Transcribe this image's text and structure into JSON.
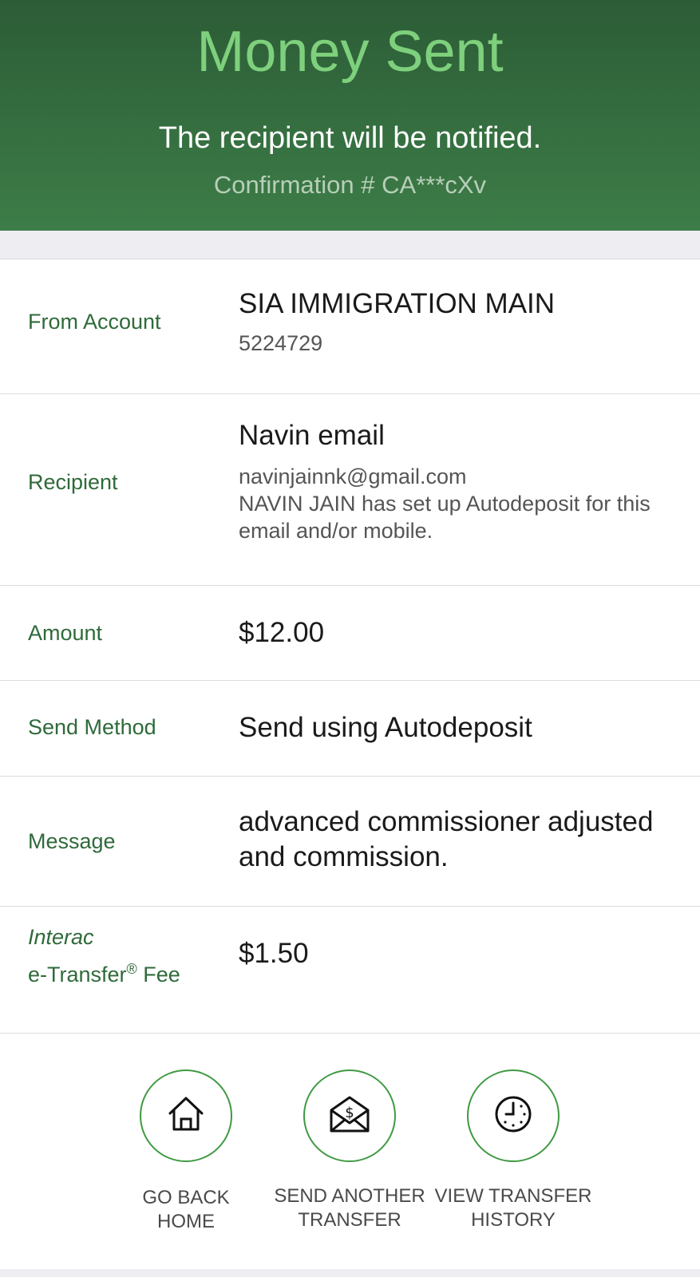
{
  "header": {
    "title": "Money Sent",
    "subtitle": "The recipient will be notified.",
    "confirmation": "Confirmation # CA***cXv"
  },
  "details": {
    "from_account": {
      "label": "From Account",
      "name": "SIA IMMIGRATION MAIN",
      "number": "5224729"
    },
    "recipient": {
      "label": "Recipient",
      "name": "Navin email",
      "email": "navinjainnk@gmail.com",
      "note": "NAVIN JAIN has set up Autodeposit for this email and/or mobile."
    },
    "amount": {
      "label": "Amount",
      "value": "$12.00"
    },
    "send_method": {
      "label": "Send Method",
      "value": "Send using Autodeposit"
    },
    "message": {
      "label": "Message",
      "value": "advanced commissioner adjusted and commission."
    },
    "fee": {
      "label_line1": "Interac",
      "label_line2_prefix": "e-Transfer",
      "label_registered": "®",
      "label_line2_suffix": " Fee",
      "value": "$1.50"
    }
  },
  "actions": [
    {
      "label": "GO BACK\nHOME",
      "icon": "home-icon"
    },
    {
      "label": "SEND ANOTHER\nTRANSFER",
      "icon": "envelope-dollar-icon"
    },
    {
      "label": "VIEW TRANSFER\nHISTORY",
      "icon": "clock-icon"
    }
  ],
  "colors": {
    "header_bg": "#3d7d48",
    "title_green": "#7ed07c",
    "label_green": "#2f6a3a",
    "action_ring": "#3f9a42"
  }
}
